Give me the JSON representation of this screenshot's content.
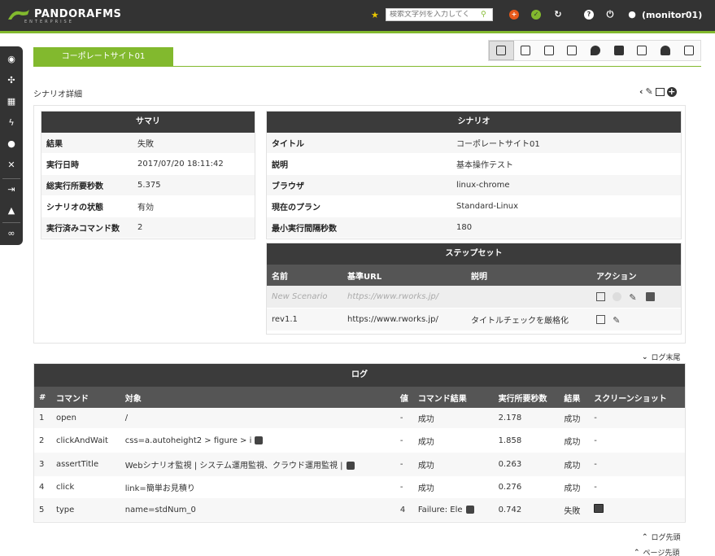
{
  "header": {
    "brand": "PANDORAFMS",
    "brand_sub": "ENTERPRISE",
    "search_placeholder": "検索文字列を入力してく",
    "user": "(monitor01)"
  },
  "tab": {
    "label": "コーポレートサイト01"
  },
  "section_title": "シナリオ詳細",
  "summary": {
    "title": "サマリ",
    "rows": [
      {
        "k": "結果",
        "v": "失敗"
      },
      {
        "k": "実行日時",
        "v": "2017/07/20 18:11:42"
      },
      {
        "k": "総実行所要秒数",
        "v": "5.375"
      },
      {
        "k": "シナリオの状態",
        "v": "有効"
      },
      {
        "k": "実行済みコマンド数",
        "v": "2"
      }
    ]
  },
  "scenario": {
    "title": "シナリオ",
    "rows": [
      {
        "k": "タイトル",
        "v": "コーポレートサイト01"
      },
      {
        "k": "説明",
        "v": "基本操作テスト"
      },
      {
        "k": "ブラウザ",
        "v": "linux-chrome"
      },
      {
        "k": "現在のプラン",
        "v": "Standard-Linux"
      },
      {
        "k": "最小実行間隔秒数",
        "v": "180"
      }
    ]
  },
  "stepset": {
    "title": "ステップセット",
    "headers": {
      "name": "名前",
      "url": "基準URL",
      "desc": "説明",
      "action": "アクション"
    },
    "rows": [
      {
        "name": "New Scenario",
        "url": "https://www.rworks.jp/",
        "desc": ""
      },
      {
        "name": "rev1.1",
        "url": "https://www.rworks.jp/",
        "desc": "タイトルチェックを厳格化"
      }
    ]
  },
  "log": {
    "link_end": "ログ末尾",
    "link_top": "ログ先頭",
    "link_page_top": "ページ先頭",
    "title": "ログ",
    "headers": {
      "n": "#",
      "cmd": "コマンド",
      "target": "対象",
      "value": "値",
      "cmd_result": "コマンド結果",
      "time": "実行所要秒数",
      "result": "結果",
      "screenshot": "スクリーンショット"
    },
    "rows": [
      {
        "n": "1",
        "cmd": "open",
        "target": "/",
        "value": "-",
        "cmd_result": "成功",
        "time": "2.178",
        "result": "成功",
        "screenshot": "-"
      },
      {
        "n": "2",
        "cmd": "clickAndWait",
        "target": "css=a.autoheight2 > figure > i",
        "value": "-",
        "cmd_result": "成功",
        "time": "1.858",
        "result": "成功",
        "screenshot": "-"
      },
      {
        "n": "3",
        "cmd": "assertTitle",
        "target": "Webシナリオ監視 | システム運用監視、クラウド運用監視 |",
        "value": "-",
        "cmd_result": "成功",
        "time": "0.263",
        "result": "成功",
        "screenshot": "-"
      },
      {
        "n": "4",
        "cmd": "click",
        "target": "link=簡単お見積り",
        "value": "-",
        "cmd_result": "成功",
        "time": "0.276",
        "result": "成功",
        "screenshot": "-"
      },
      {
        "n": "5",
        "cmd": "type",
        "target": "name=stdNum_0",
        "value": "4",
        "cmd_result": "Failure: Ele",
        "time": "0.742",
        "result": "失敗",
        "screenshot": ""
      }
    ]
  },
  "colors": {
    "accent": "#82b92e",
    "header": "#333333",
    "table_head": "#3b3b3b"
  }
}
